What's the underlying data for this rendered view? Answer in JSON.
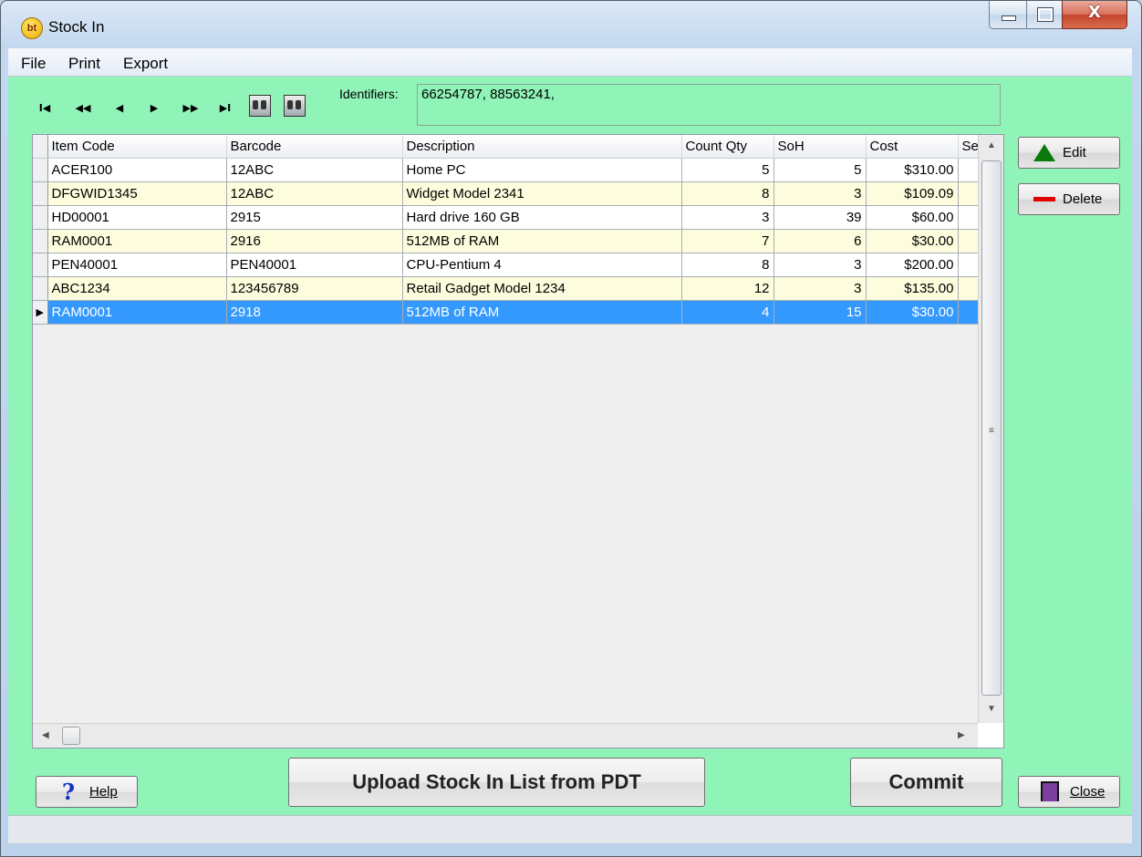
{
  "window": {
    "title": "Stock In",
    "app_icon_text": "bt"
  },
  "title_buttons": {
    "close_symbol": "X"
  },
  "menu": [
    "File",
    "Print",
    "Export"
  ],
  "navigator": {
    "first": "I◀",
    "prev_page": "◀◀",
    "prev": "◀",
    "next": "▶",
    "next_page": "▶▶",
    "last": "▶I"
  },
  "identifiers": {
    "label": "Identifiers:",
    "value": "66254787, 88563241,"
  },
  "grid": {
    "columns": [
      "Item Code",
      "Barcode",
      "Description",
      "Count Qty",
      "SoH",
      "Cost",
      "Se"
    ],
    "rows": [
      {
        "item_code": "ACER100",
        "barcode": "12ABC",
        "description": "Home PC",
        "count_qty": "5",
        "soh": "5",
        "cost": "$310.00"
      },
      {
        "item_code": "DFGWID1345",
        "barcode": "12ABC",
        "description": "Widget Model 2341",
        "count_qty": "8",
        "soh": "3",
        "cost": "$109.09"
      },
      {
        "item_code": "HD00001",
        "barcode": "2915",
        "description": "Hard drive 160 GB",
        "count_qty": "3",
        "soh": "39",
        "cost": "$60.00"
      },
      {
        "item_code": "RAM0001",
        "barcode": "2916",
        "description": "512MB of RAM",
        "count_qty": "7",
        "soh": "6",
        "cost": "$30.00"
      },
      {
        "item_code": "PEN40001",
        "barcode": "PEN40001",
        "description": "CPU-Pentium 4",
        "count_qty": "8",
        "soh": "3",
        "cost": "$200.00"
      },
      {
        "item_code": "ABC1234",
        "barcode": "123456789",
        "description": "Retail Gadget Model 1234",
        "count_qty": "12",
        "soh": "3",
        "cost": "$135.00"
      },
      {
        "item_code": "RAM0001",
        "barcode": "2918",
        "description": "512MB of RAM",
        "count_qty": "4",
        "soh": "15",
        "cost": "$30.00"
      }
    ],
    "selected_row_index": 6,
    "current_row_marker": "▶"
  },
  "buttons": {
    "edit": "Edit",
    "delete": "Delete",
    "upload": "Upload Stock In List from PDT",
    "commit": "Commit",
    "help": "Help",
    "close": "Close"
  },
  "colors": {
    "client_bg": "#90f4b8",
    "selection": "#3399ff",
    "alt_row": "#fdfcdc"
  }
}
